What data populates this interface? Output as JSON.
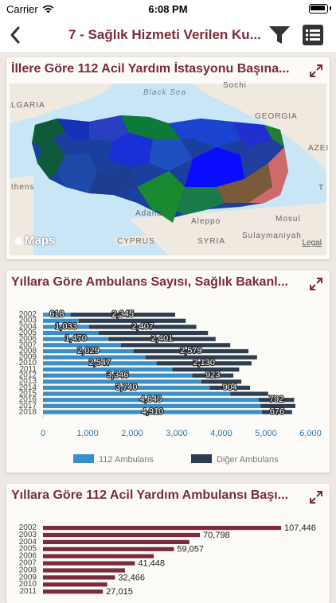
{
  "status": {
    "carrier": "Carrier",
    "time": "6:08 PM"
  },
  "nav": {
    "title": "7 - Sağlık Hizmeti Verilen Ku..."
  },
  "colors": {
    "accent": "#7b2b3b",
    "blue": "#3a8fc8",
    "dark": "#2d3e50",
    "maroon": "#7b2b3b"
  },
  "cards": {
    "map": {
      "title": "İllere Göre 112 Acil Yardım İstasyonu Başına...",
      "logo": "Maps",
      "legal": "Legal",
      "labels": {
        "black_sea": "Black Sea",
        "sochi": "Sochi",
        "bulgaria": "LGARIA",
        "georgia": "GEORGIA",
        "azerbaijan": "AZEI",
        "athens": "thens",
        "adana": "Adana",
        "aleppo": "Aleppo",
        "mosul": "Mosul",
        "cyprus": "CYPRUS",
        "syria": "SYRIA",
        "sulaymaniyah": "Sulaymaniyah",
        "t": "T"
      }
    },
    "ambulance": {
      "title": "Yıllara Göre Ambulans Sayısı, Sağlık Bakanl..."
    },
    "rate": {
      "title": "Yıllara Göre 112 Acil Yardım Ambulansı Başı..."
    }
  },
  "chart_data": [
    {
      "type": "bar",
      "orientation": "horizontal",
      "stacked": true,
      "categories": [
        "2002",
        "2003",
        "2004",
        "2005",
        "2006",
        "2007",
        "2008",
        "2009",
        "2010",
        "2011",
        "2012",
        "2013",
        "2014",
        "2015",
        "2016",
        "2017",
        "2018"
      ],
      "series": [
        {
          "name": "112 Ambulans",
          "values": [
            618,
            800,
            1033,
            1250,
            1470,
            1750,
            2029,
            2300,
            2547,
            2900,
            3346,
            3550,
            3740,
            4200,
            4840,
            4880,
            4910
          ]
        },
        {
          "name": "Diğer Ambulans",
          "values": [
            2345,
            2400,
            2407,
            2450,
            2401,
            2450,
            2579,
            2500,
            2130,
            1500,
            923,
            900,
            904,
            850,
            792,
            780,
            676
          ]
        }
      ],
      "value_labels": {
        "112 Ambulans": {
          "2002": "618",
          "2004": "1,033",
          "2006": "1,470",
          "2008": "2,029",
          "2010": "2,547",
          "2012": "3,346",
          "2014": "3,740",
          "2016": "4,840",
          "2018": "4,910"
        },
        "Diğer Ambulans": {
          "2002": "2,345",
          "2004": "2,407",
          "2006": "2,401",
          "2008": "2,579",
          "2010": "2,130",
          "2012": "923",
          "2014": "904",
          "2016": "792",
          "2018": "676"
        }
      },
      "x_ticks": [
        "0",
        "1,000",
        "2,000",
        "3,000",
        "4,000",
        "5,000",
        "6,000"
      ],
      "xlim": [
        0,
        6000
      ],
      "legend": "bottom",
      "grid": false
    },
    {
      "type": "bar",
      "orientation": "horizontal",
      "categories": [
        "2002",
        "2003",
        "2004",
        "2005",
        "2006",
        "2007",
        "2008",
        "2009",
        "2010",
        "2011"
      ],
      "series": [
        {
          "values": [
            107446,
            70798,
            66000,
            59057,
            50000,
            41448,
            37000,
            32466,
            29000,
            27015
          ]
        }
      ],
      "value_labels": {
        "2002": "107,446",
        "2003": "70,798",
        "2005": "59,057",
        "2007": "41,448",
        "2009": "32,466",
        "2011": "27,015"
      },
      "xlim": [
        0,
        120000
      ]
    }
  ]
}
